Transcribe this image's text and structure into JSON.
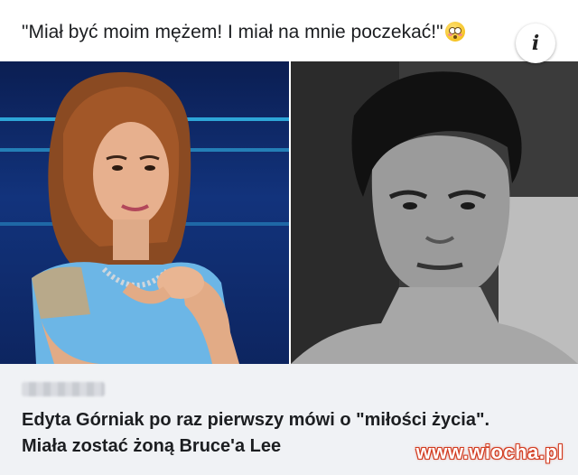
{
  "post": {
    "caption": "\"Miał być moim mężem! I miał na mnie poczekać!\"",
    "caption_emoji": "flushed-face-emoji"
  },
  "link_preview": {
    "info_icon": "i",
    "headline_line1": "Edyta Górniak po raz pierwszy mówi o \"miłości życia\".",
    "headline_line2": "Miała zostać żoną Bruce'a Lee"
  },
  "watermark": "www.wiocha.pl",
  "colors": {
    "footer_bg": "#f0f2f5",
    "text": "#1c1e21",
    "watermark_outline": "#d23a1e",
    "stage_blue": "#12337c"
  }
}
